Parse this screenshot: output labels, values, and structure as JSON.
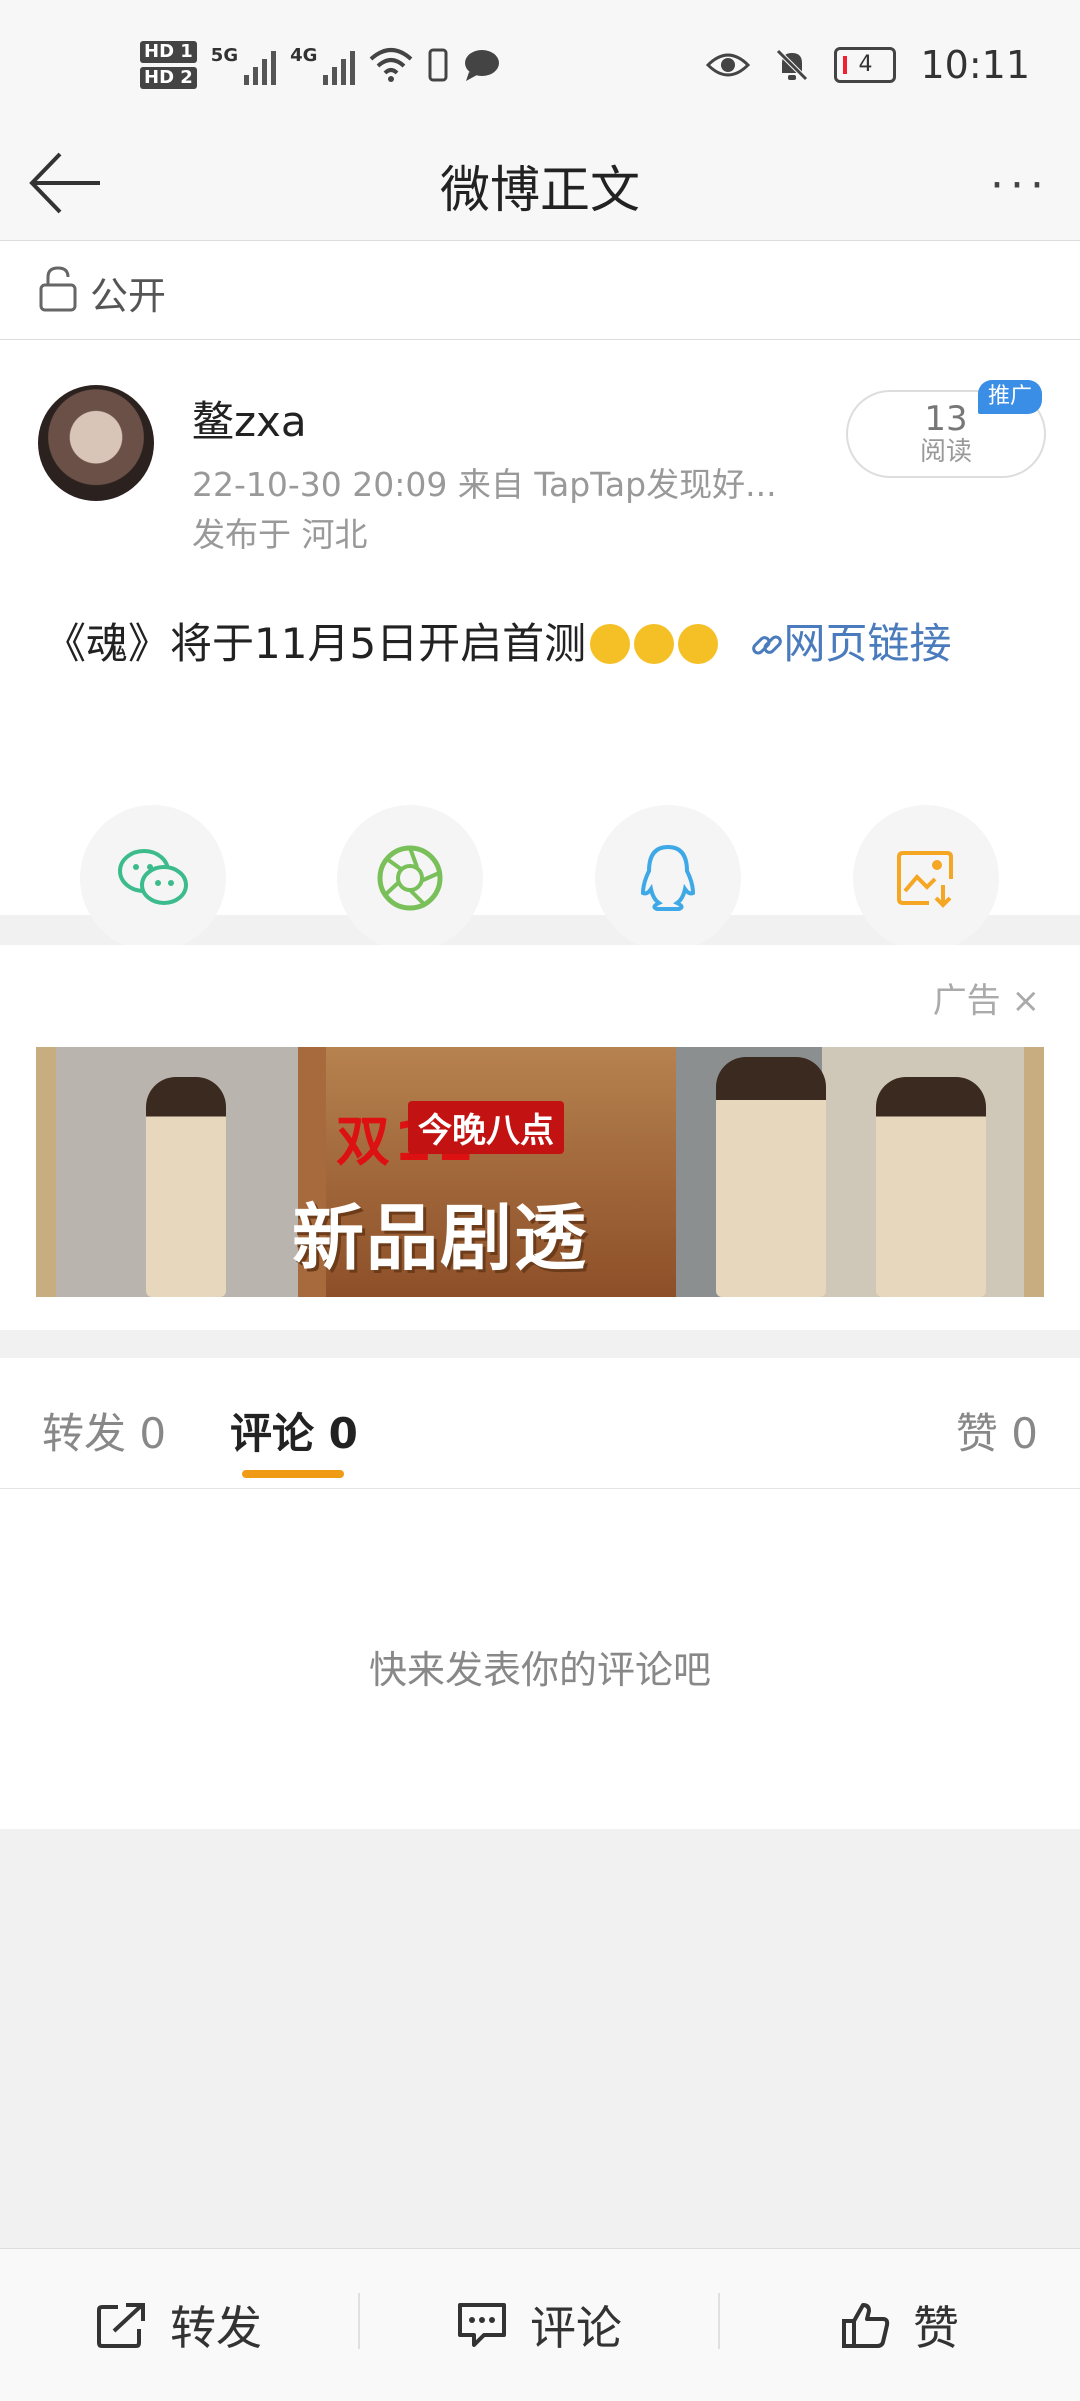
{
  "status_bar": {
    "hd1": "HD 1",
    "hd2": "HD 2",
    "net1": "5G",
    "net2": "4G",
    "battery": "4",
    "time": "10:11"
  },
  "nav": {
    "title": "微博正文",
    "more": "···"
  },
  "visibility": {
    "label": "公开"
  },
  "post": {
    "username": "鳌zxa",
    "meta": "22-10-30 20:09   来自 TapTap发现好...",
    "location": "发布于 河北",
    "reads_count": "13",
    "reads_label": "阅读",
    "promo_badge": "推广",
    "content_text": "《魂》将于11月5日开启首测",
    "link_text": "网页链接"
  },
  "share": {
    "icons": [
      "wechat-icon",
      "moments-icon",
      "qq-icon",
      "save-image-icon"
    ]
  },
  "ad": {
    "label": "广告",
    "close": "×",
    "banner_t1": "双11",
    "banner_t2": "今晚八点",
    "banner_t3": "新品剧透"
  },
  "tabs": {
    "repost": "转发 0",
    "comment": "评论 0",
    "like": "赞 0"
  },
  "comments": {
    "empty_text": "快来发表你的评论吧"
  },
  "bottom_bar": {
    "repost": "转发",
    "comment": "评论",
    "like": "赞"
  },
  "colors": {
    "accent_orange": "#f09b15",
    "link_blue": "#4a7bbd",
    "wechat_green": "#3cbc8d",
    "moments_green": "#7ac05a",
    "qq_blue": "#3fa8e6",
    "save_orange": "#f5a623"
  }
}
